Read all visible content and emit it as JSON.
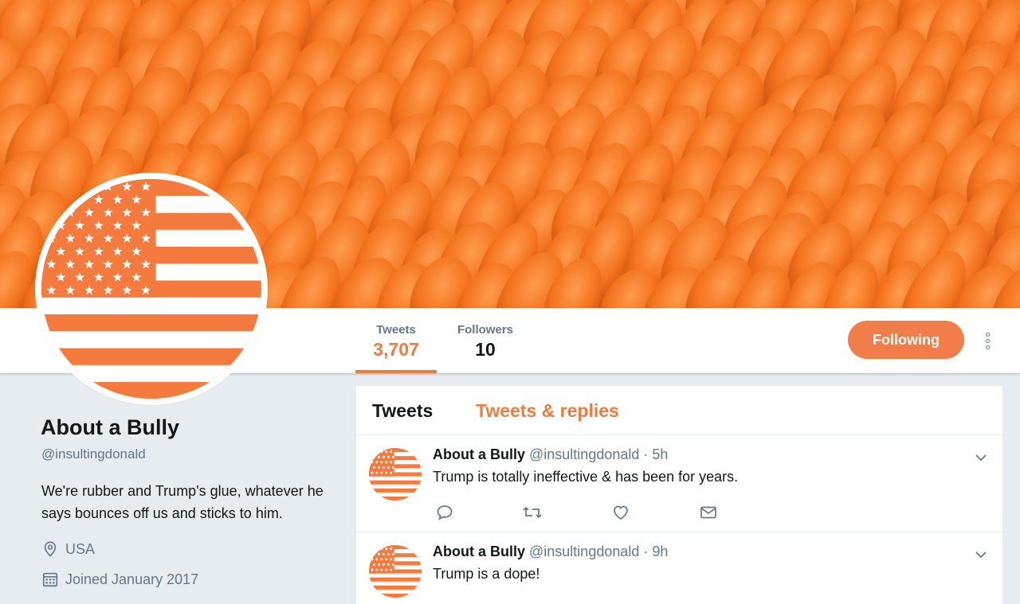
{
  "profile": {
    "name": "About a Bully",
    "handle": "@insultingdonald",
    "bio": "We're rubber and Trump's glue, whatever he says bounces off us and sticks to him.",
    "location": "USA",
    "joined": "Joined January 2017",
    "location_icon": "location-pin-icon",
    "joined_icon": "calendar-icon",
    "banner_icon": "orange-fuzzy-banner",
    "avatar_icon": "orange-flag-avatar"
  },
  "nav": {
    "stats": [
      {
        "label": "Tweets",
        "value": "3,707",
        "active": true
      },
      {
        "label": "Followers",
        "value": "10",
        "active": false
      }
    ],
    "follow_label": "Following",
    "more_icon": "more-vertical-icon"
  },
  "timeline": {
    "tabs": [
      {
        "label": "Tweets",
        "active": true
      },
      {
        "label": "Tweets & replies",
        "active": false
      }
    ],
    "tweets": [
      {
        "name": "About a Bully",
        "handle": "@insultingdonald",
        "dot": "·",
        "time": "5h",
        "text": "Trump is totally ineffective & has been for years."
      },
      {
        "name": "About a Bully",
        "handle": "@insultingdonald",
        "dot": "·",
        "time": "9h",
        "text": "Trump is a dope!"
      }
    ],
    "action_icons": [
      "reply-icon",
      "retweet-icon",
      "like-icon",
      "direct-message-icon"
    ]
  },
  "colors": {
    "accent": "#f07a3f",
    "button": "#f17e4a",
    "banner": "#f26b1d",
    "flag_orange": "#f47a3e",
    "muted": "#657786",
    "page_bg": "#e6ecf0"
  }
}
